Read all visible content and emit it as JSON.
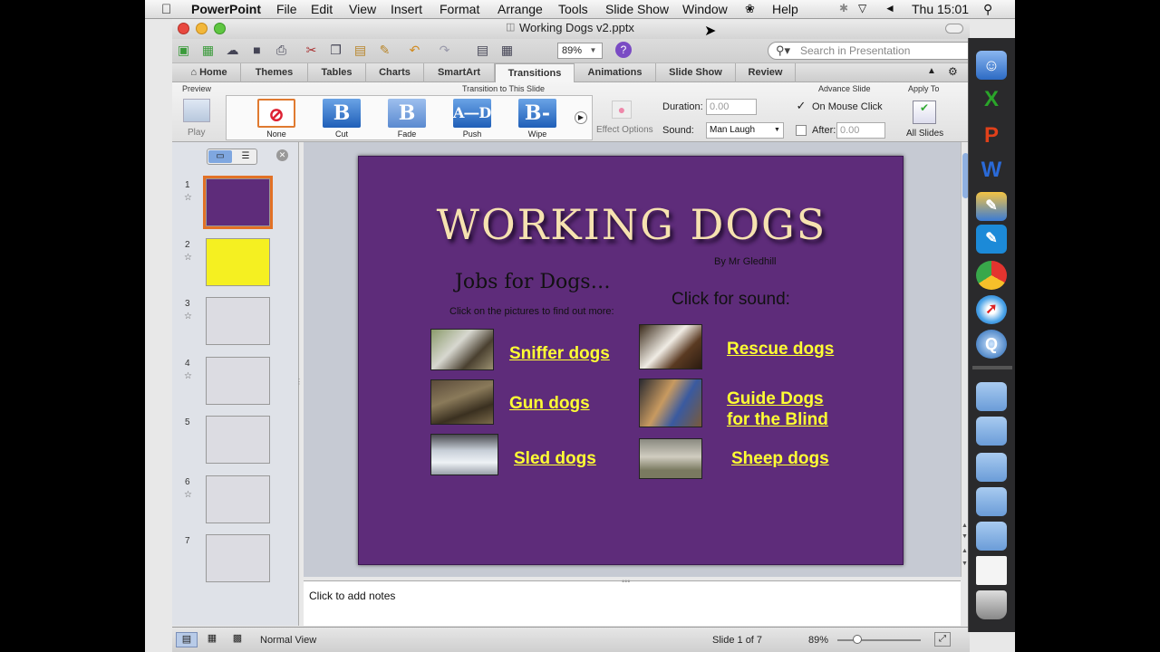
{
  "menubar": {
    "app_name": "PowerPoint",
    "items": [
      "File",
      "Edit",
      "View",
      "Insert",
      "Format",
      "Arrange",
      "Tools",
      "Slide Show",
      "Window",
      "Help"
    ],
    "clock": "Thu 15:01"
  },
  "window": {
    "title": "Working Dogs v2.pptx"
  },
  "toolbar": {
    "zoom": "89%",
    "search_placeholder": "Search in Presentation"
  },
  "tabs": [
    "Home",
    "Themes",
    "Tables",
    "Charts",
    "SmartArt",
    "Transitions",
    "Animations",
    "Slide Show",
    "Review"
  ],
  "active_tab": "Transitions",
  "ribbon": {
    "preview_label": "Preview",
    "play_label": "Play",
    "transition_group_label": "Transition to This Slide",
    "transitions": [
      "None",
      "Cut",
      "Fade",
      "Push",
      "Wipe"
    ],
    "effect_options_label": "Effect Options",
    "duration_label": "Duration:",
    "duration_value": "0.00",
    "sound_label": "Sound:",
    "sound_value": "Man Laugh",
    "advance_label": "Advance Slide",
    "on_mouse_click_label": "On Mouse Click",
    "on_mouse_click_checked": true,
    "after_label": "After:",
    "after_value": "0.00",
    "apply_label": "Apply To",
    "all_slides_label": "All Slides"
  },
  "slides": [
    {
      "number": "1",
      "has_animation": true,
      "bg": "#5e2c7a",
      "selected": true
    },
    {
      "number": "2",
      "has_animation": true,
      "bg": "#f5f021",
      "selected": false
    },
    {
      "number": "3",
      "has_animation": true,
      "bg": "#dcdce2",
      "selected": false
    },
    {
      "number": "4",
      "has_animation": true,
      "bg": "#dcdce2",
      "selected": false
    },
    {
      "number": "5",
      "has_animation": false,
      "bg": "#dcdce2",
      "selected": false
    },
    {
      "number": "6",
      "has_animation": true,
      "bg": "#dcdce2",
      "selected": false
    },
    {
      "number": "7",
      "has_animation": false,
      "bg": "#dcdce2",
      "selected": false
    }
  ],
  "slide": {
    "title": "WORKING DOGS",
    "author": "By Mr Gledhill",
    "jobs_heading": "Jobs for Dogs…",
    "jobs_subtext": "Click on the pictures to find out more:",
    "sound_heading": "Click for sound:",
    "links_left": [
      "Sniffer dogs",
      "Gun dogs",
      "Sled dogs"
    ],
    "links_right": [
      "Rescue dogs",
      "Guide Dogs",
      "for the Blind",
      "Sheep dogs"
    ]
  },
  "notes_placeholder": "Click to add notes",
  "status": {
    "view_name": "Normal View",
    "slide_indicator": "Slide 1 of 7",
    "zoom": "89%"
  }
}
